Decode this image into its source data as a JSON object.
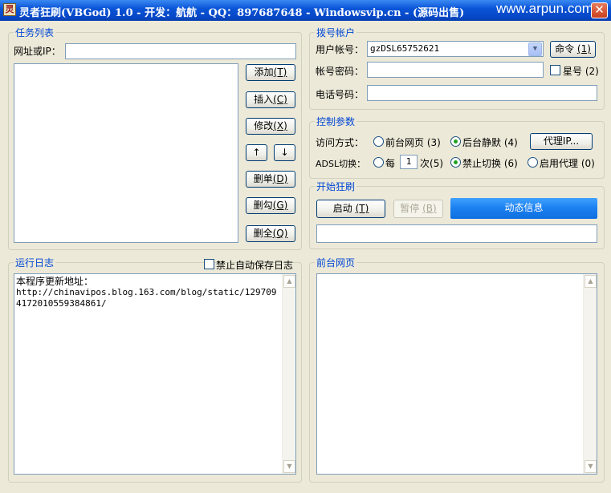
{
  "window": {
    "title": "灵者狂刷(VBGod) 1.0 - 开发：航航 - QQ：897687648 - Windowsvip.cn - (源码出售)",
    "watermark": "www.arpun.com",
    "close_glyph": "✕"
  },
  "task_list": {
    "legend": "任务列表",
    "url_label": "网址或IP：",
    "url_value": "",
    "buttons": {
      "add": "添加",
      "add_key": "(T)",
      "insert": "插入",
      "insert_key": "(C)",
      "modify": "修改",
      "modify_key": "(X)",
      "up": "↑",
      "down": "↓",
      "delete_one": "删单",
      "delete_one_key": "(D)",
      "delete_checked": "删勾",
      "delete_checked_key": "(G)",
      "delete_all": "删全",
      "delete_all_key": "(Q)"
    }
  },
  "dial_account": {
    "legend": "拨号帐户",
    "user_label": "用户帐号：",
    "user_value": "gzDSL65752621",
    "command_button": "命令",
    "command_key": "(1)",
    "password_label": "帐号密码：",
    "password_value": "",
    "star_label": "星号",
    "star_key": "(2)",
    "phone_label": "电话号码：",
    "phone_value": ""
  },
  "control": {
    "legend": "控制参数",
    "access_label": "访问方式：",
    "front_label": "前台网页",
    "front_key": "(3)",
    "back_label": "后台静默",
    "back_key": "(4)",
    "proxy_button": "代理IP...",
    "adsl_label": "ADSL切换：",
    "every_label": "每",
    "every_value": "1",
    "times_label": "次",
    "times_key": "(5)",
    "no_switch_label": "禁止切换",
    "no_switch_key": "(6)",
    "use_proxy_label": "启用代理",
    "use_proxy_key": "(0)"
  },
  "start": {
    "legend": "开始狂刷",
    "start_button": "启动",
    "start_key": "(T)",
    "pause_button": "暂停",
    "pause_key": "(B)",
    "dynamic_info": "动态信息",
    "status_value": ""
  },
  "log": {
    "legend": "运行日志",
    "disable_autosave": "禁止自动保存日志",
    "line1": "本程序更新地址：",
    "line2": "http://chinavipos.blog.163.com/blog/static/1297094172010559384861/"
  },
  "front_page": {
    "legend": "前台网页"
  }
}
